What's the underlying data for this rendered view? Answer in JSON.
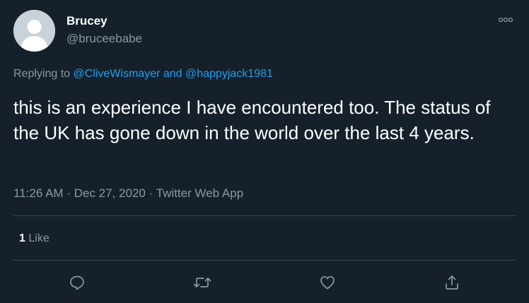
{
  "author": {
    "display_name": "Brucey",
    "handle": "@bruceebabe"
  },
  "header": {
    "more_icon": "more-dots-icon"
  },
  "reply_context": {
    "prefix": "Replying to",
    "mention_1": "@CliveWismayer",
    "connector": "and",
    "mention_2": "@happyjack1981"
  },
  "tweet": {
    "text": "this is an experience I have encountered too. The status of the UK has gone down in the world over the last 4 years."
  },
  "meta": {
    "time": "11:26 AM",
    "date": "Dec 27, 2020",
    "source": "Twitter Web App",
    "separator": "·"
  },
  "stats": {
    "likes_count": "1",
    "likes_label": "Like"
  },
  "actions": [
    {
      "name": "reply",
      "icon": "reply-icon"
    },
    {
      "name": "retweet",
      "icon": "retweet-icon"
    },
    {
      "name": "like",
      "icon": "heart-icon"
    },
    {
      "name": "share",
      "icon": "share-icon"
    }
  ],
  "colors": {
    "background": "#15202b",
    "text_primary": "#ffffff",
    "text_secondary": "#8899a6",
    "accent": "#1da1f2",
    "divider": "#38444d",
    "avatar_bg": "#c9d1d9",
    "avatar_fg": "#ffffff"
  }
}
